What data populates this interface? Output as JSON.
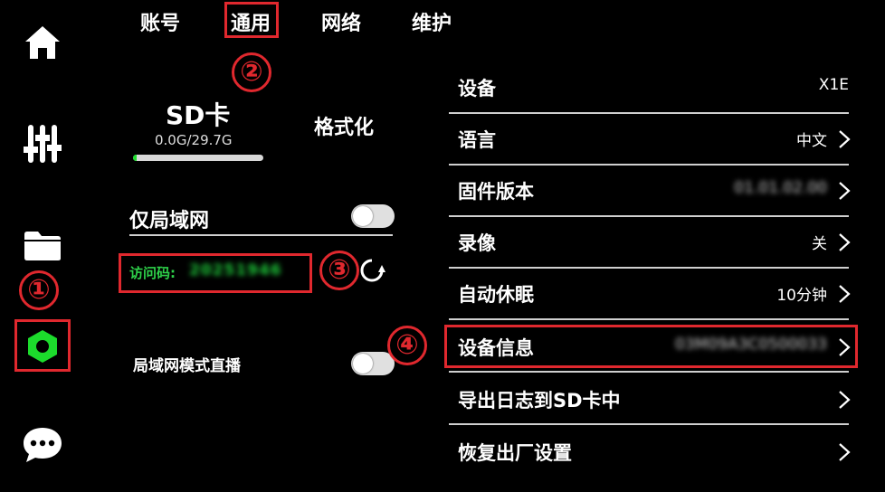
{
  "tabs": [
    "账号",
    "通用",
    "网络",
    "维护"
  ],
  "active_tab": "通用",
  "markers": [
    "①",
    "②",
    "③",
    "④"
  ],
  "sidebar": {
    "items": [
      {
        "icon": "home-icon"
      },
      {
        "icon": "sliders-icon"
      },
      {
        "icon": "folder-icon"
      },
      {
        "icon": "settings-hex-icon",
        "active": true
      },
      {
        "icon": "chat-icon"
      }
    ]
  },
  "sd_card": {
    "title": "SD卡",
    "usage": "0.0G/29.7G",
    "used_fraction": 0.03,
    "format_label": "格式化"
  },
  "lan_only": {
    "label": "仅局域网",
    "enabled": false
  },
  "access_code": {
    "label": "访问码:",
    "value": "20251946"
  },
  "lan_live": {
    "label": "局域网模式直播",
    "enabled": false
  },
  "settings": [
    {
      "label": "设备",
      "value": "X1E",
      "chevron": false,
      "blurred": false
    },
    {
      "label": "语言",
      "value": "中文",
      "chevron": true,
      "blurred": false
    },
    {
      "label": "固件版本",
      "value": "01.01.02.00",
      "chevron": true,
      "blurred": true
    },
    {
      "label": "录像",
      "value": "关",
      "chevron": true,
      "blurred": false
    },
    {
      "label": "自动休眠",
      "value": "10分钟",
      "chevron": true,
      "blurred": false
    },
    {
      "label": "设备信息",
      "value": "03M09A3C0500033",
      "chevron": true,
      "blurred": true
    },
    {
      "label": "导出日志到SD卡中",
      "value": "",
      "chevron": true,
      "blurred": false
    },
    {
      "label": "恢复出厂设置",
      "value": "",
      "chevron": true,
      "blurred": false
    }
  ],
  "colors": {
    "background": "#000000",
    "accent_green": "#1cdc2c",
    "annotation_red": "#e0282e"
  }
}
